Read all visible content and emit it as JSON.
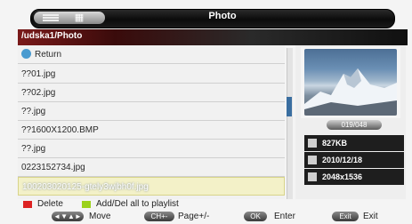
{
  "title": "Photo",
  "path": "/udska1/Photo",
  "files": {
    "return_label": "Return",
    "items": [
      "??01.jpg",
      "??02.jpg",
      "??.jpg",
      "??1600X1200.BMP",
      "??.jpg",
      "0223152734.jpg",
      "100203020125-gtely3wjbh0f.jpg"
    ],
    "selected_index": 6
  },
  "preview": {
    "page_indicator": "019/048",
    "size": "827KB",
    "date": "2010/12/18",
    "resolution": "2048x1536"
  },
  "hints": {
    "delete": "Delete",
    "add_playlist": "Add/Del all to playlist",
    "move_key": "◄▼▲►",
    "move": "Move",
    "page_key": "CH+-",
    "page": "Page+/-",
    "enter_key": "OK",
    "enter": "Enter",
    "exit_key": "Exit",
    "exit": "Exit"
  },
  "colors": {
    "delete_key": "#dd2222",
    "add_key": "#9bd21b",
    "scroll_thumb": "#3a6ea0"
  }
}
